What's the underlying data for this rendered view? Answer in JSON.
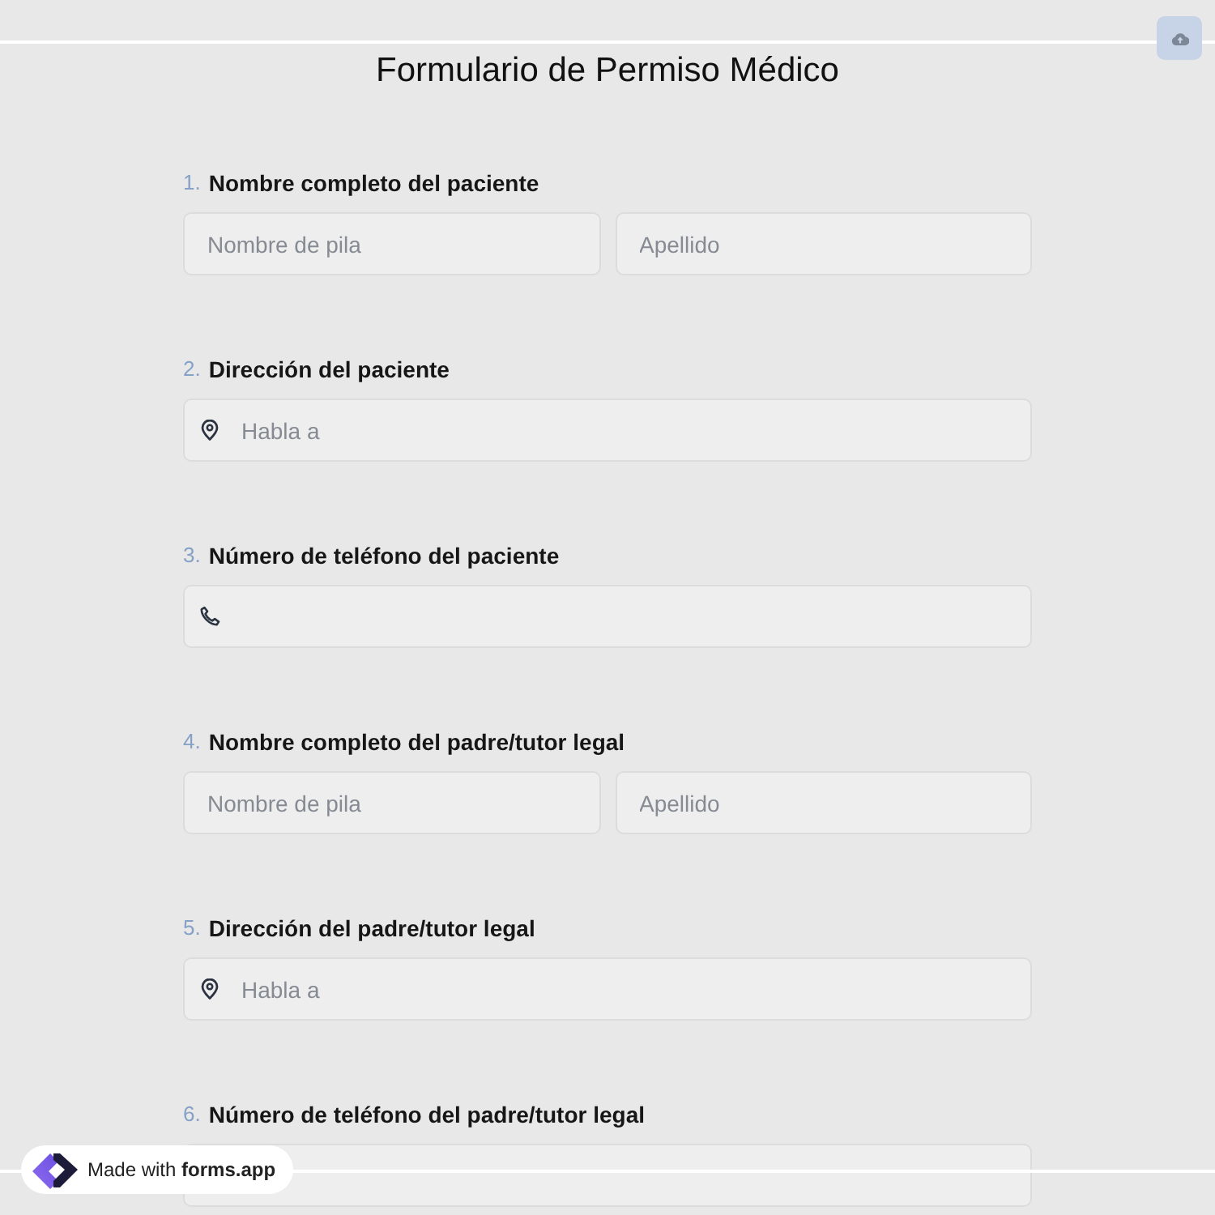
{
  "header": {
    "title": "Formulario de Permiso Médico"
  },
  "questions": [
    {
      "number": "1.",
      "label": "Nombre completo del paciente",
      "inputs": [
        {
          "kind": "text",
          "placeholder": "Nombre de pila"
        },
        {
          "kind": "text",
          "placeholder": "Apellido"
        }
      ]
    },
    {
      "number": "2.",
      "label": "Dirección del paciente",
      "inputs": [
        {
          "kind": "address",
          "placeholder": "Habla a"
        }
      ]
    },
    {
      "number": "3.",
      "label": "Número de teléfono del paciente",
      "inputs": [
        {
          "kind": "phone"
        }
      ]
    },
    {
      "number": "4.",
      "label": "Nombre completo del padre/tutor legal",
      "inputs": [
        {
          "kind": "text",
          "placeholder": "Nombre de pila"
        },
        {
          "kind": "text",
          "placeholder": "Apellido"
        }
      ]
    },
    {
      "number": "5.",
      "label": "Dirección del padre/tutor legal",
      "inputs": [
        {
          "kind": "address",
          "placeholder": "Habla a"
        }
      ]
    },
    {
      "number": "6.",
      "label": "Número de teléfono del padre/tutor legal",
      "inputs": [
        {
          "kind": "text"
        }
      ]
    }
  ],
  "badge": {
    "text": "Made with **forms.app**"
  }
}
